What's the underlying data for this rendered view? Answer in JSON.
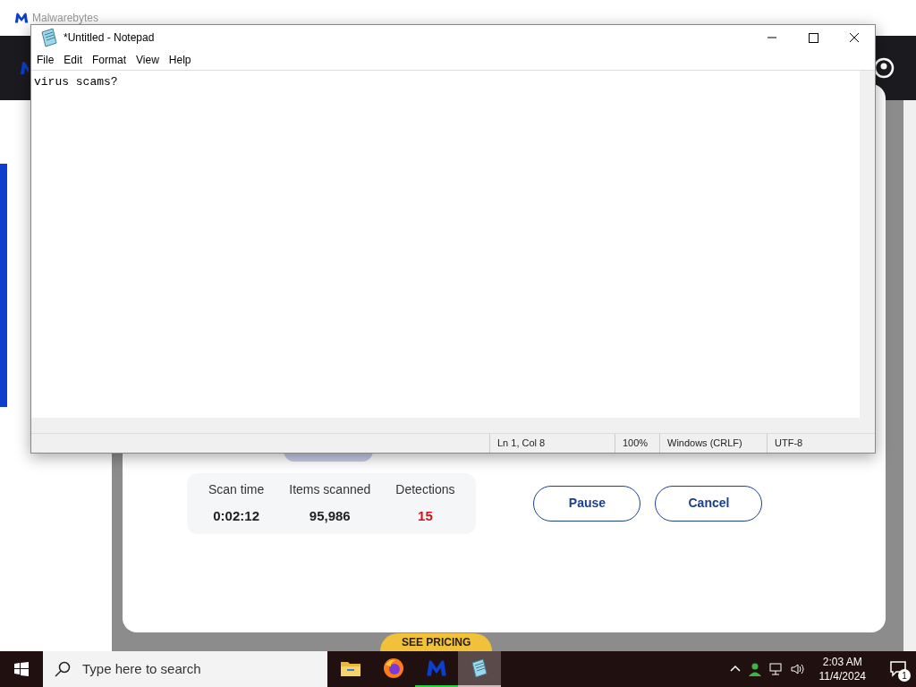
{
  "background_window": {
    "title": "Malwarebytes",
    "stats": [
      {
        "label": "Scan time",
        "value": "0:02:12",
        "kind": "normal"
      },
      {
        "label": "Items scanned",
        "value": "95,986",
        "kind": "normal"
      },
      {
        "label": "Detections",
        "value": "15",
        "kind": "alert"
      }
    ],
    "buttons": [
      "Pause",
      "Cancel"
    ],
    "promo": "SEE PRICING"
  },
  "notepad": {
    "title": "*Untitled - Notepad",
    "menu": [
      "File",
      "Edit",
      "Format",
      "View",
      "Help"
    ],
    "text": "virus scams?",
    "status": [
      "Ln 1, Col 8",
      "100%",
      "Windows (CRLF)",
      "UTF-8"
    ]
  },
  "taskbar": {
    "search": {
      "placeholder": "Type here to search"
    },
    "apps": [
      {
        "kind": "folder",
        "selected": false,
        "attention": false
      },
      {
        "kind": "browser",
        "selected": false,
        "attention": false
      },
      {
        "kind": "malwarebytes",
        "selected": false,
        "attention": true
      },
      {
        "kind": "notepad",
        "selected": true,
        "attention": false
      }
    ],
    "time": "2:03 AM",
    "date": "11/4/2024",
    "notifications": "1"
  }
}
